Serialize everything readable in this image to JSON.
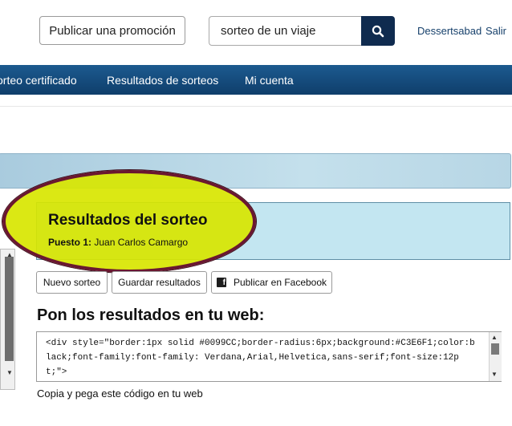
{
  "header": {
    "promo_button": "Publicar una promoción",
    "search_value": "sorteo de un viaje",
    "user_name": "Dessertsabad",
    "logout": "Salir"
  },
  "nav": {
    "items": [
      "orteo certificado",
      "Resultados de sorteos",
      "Mi cuenta"
    ]
  },
  "results": {
    "title": "Resultados del sorteo",
    "winner_prefix": "Puesto 1:",
    "winner_name": "Juan Carlos Camargo"
  },
  "actions": {
    "new_draw": "Nuevo sorteo",
    "save_results": "Guardar resultados",
    "facebook": "Publicar en Facebook"
  },
  "embed": {
    "heading": "Pon los resultados en tu web:",
    "code": "<div style=\"border:1px solid #0099CC;border-radius:6px;background:#C3E6F1;color:black;font-family:font-family: Verdana,Arial,Helvetica,sans-serif;font-size:12pt;\">",
    "hint": "Copia y pega este código en tu web"
  },
  "colors": {
    "nav": "#0f3e6b",
    "results_bg": "#C3E6F1",
    "highlight": "#d8e600",
    "highlight_border": "#6a1730",
    "link": "#16406b"
  }
}
